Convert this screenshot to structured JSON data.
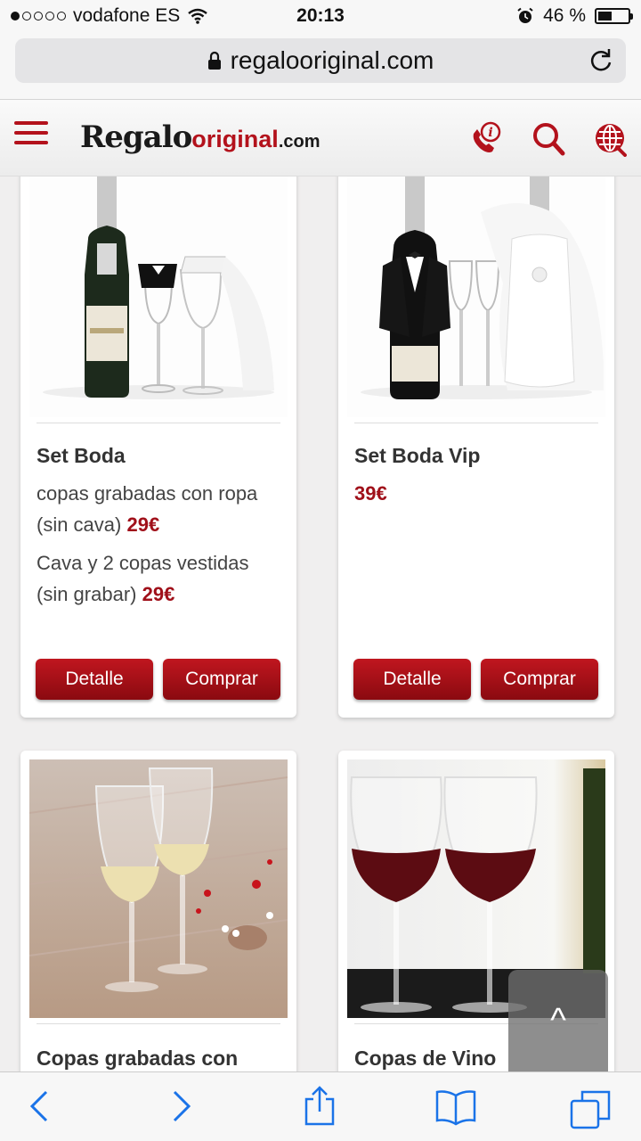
{
  "status_bar": {
    "carrier": "vodafone ES",
    "time": "20:13",
    "battery": "46 %",
    "battery_level": 0.46,
    "signal_bars": 1
  },
  "browser": {
    "url": "regalooriginal.com"
  },
  "site": {
    "logo_part1": "Regalo",
    "logo_part2": "original",
    "logo_part3": ".com",
    "accent_color": "#b3121c"
  },
  "products": [
    {
      "title": "Set Boda",
      "lines": [
        {
          "text": "copas grabadas con ropa (sin cava)",
          "price": "29€"
        },
        {
          "text": "Cava y 2 copas vestidas (sin grabar)",
          "price": "29€"
        }
      ],
      "detail_label": "Detalle",
      "buy_label": "Comprar"
    },
    {
      "title": "Set Boda Vip",
      "lines": [
        {
          "text": "",
          "price": "39€"
        }
      ],
      "detail_label": "Detalle",
      "buy_label": "Comprar"
    },
    {
      "title": "Copas grabadas con"
    },
    {
      "title": "Copas de Vino"
    }
  ],
  "scroll_top_label": "^"
}
